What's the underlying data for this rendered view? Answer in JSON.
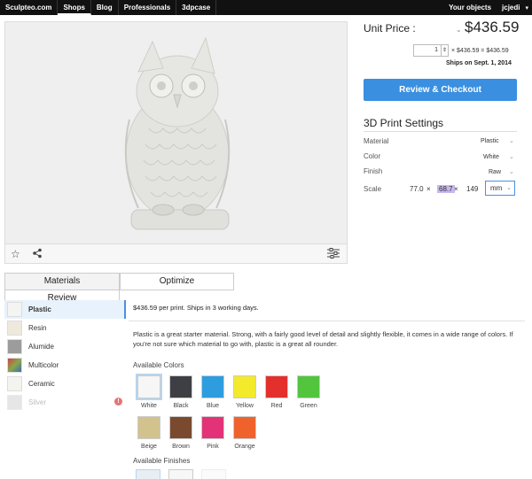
{
  "nav": {
    "items": [
      {
        "label": "Sculpteo.com"
      },
      {
        "label": "Shops"
      },
      {
        "label": "Blog"
      },
      {
        "label": "Professionals"
      },
      {
        "label": "3dpcase"
      }
    ],
    "active_index": 1,
    "your_objects": "Your objects",
    "user": "jcjedi"
  },
  "viewer": {
    "icons": [
      "star-icon",
      "share-icon",
      "settings-sliders-icon"
    ]
  },
  "pricing": {
    "unit_price_label": "Unit Price :",
    "unit_price_value": "$436.59",
    "quantity": "1",
    "formula": "× $436.59 = $436.59",
    "ships_on": "Ships on Sept. 1, 2014",
    "review_button": "Review & Checkout"
  },
  "print_settings": {
    "title": "3D Print Settings",
    "material_label": "Material",
    "material_value": "Plastic",
    "color_label": "Color",
    "color_value": "White",
    "finish_label": "Finish",
    "finish_value": "Raw",
    "scale_label": "Scale",
    "scale_x": "77.0",
    "scale_y": "68.7",
    "scale_z": "149",
    "times": "×",
    "unit": "mm"
  },
  "tabs": {
    "materials": "Materials",
    "optimize": "Optimize",
    "review": "Review"
  },
  "materials": [
    {
      "name": "Plastic",
      "swatch": "#f4f4f2"
    },
    {
      "name": "Resin",
      "swatch": "#efe8dc"
    },
    {
      "name": "Alumide",
      "swatch": "#9c9c9c"
    },
    {
      "name": "Multicolor",
      "swatch": "#8aa64a"
    },
    {
      "name": "Ceramic",
      "swatch": "#f3f3f0"
    },
    {
      "name": "Silver",
      "swatch": "#d6d6d6"
    }
  ],
  "material_detail": {
    "price_line": "$436.59 per print. Ships in 3 working days.",
    "description": "Plastic is a great starter material. Strong, with a fairly good level of detail and slightly flexible, it comes in a wide range of colors. If you're not sure which material to go with, plastic is a great all rounder.",
    "available_colors_label": "Available Colors",
    "available_finishes_label": "Available Finishes",
    "colors": [
      {
        "name": "White",
        "hex": "#f6f6f6"
      },
      {
        "name": "Black",
        "hex": "#3d3f44"
      },
      {
        "name": "Blue",
        "hex": "#2d9de0"
      },
      {
        "name": "Yellow",
        "hex": "#f2ea2b"
      },
      {
        "name": "Red",
        "hex": "#e4302c"
      },
      {
        "name": "Green",
        "hex": "#52c43e"
      },
      {
        "name": "Beige",
        "hex": "#d2c28e"
      },
      {
        "name": "Brown",
        "hex": "#7a4a2e"
      },
      {
        "name": "Pink",
        "hex": "#e43279"
      },
      {
        "name": "Orange",
        "hex": "#f0622c"
      }
    ]
  },
  "accent": "#3a8fe0"
}
